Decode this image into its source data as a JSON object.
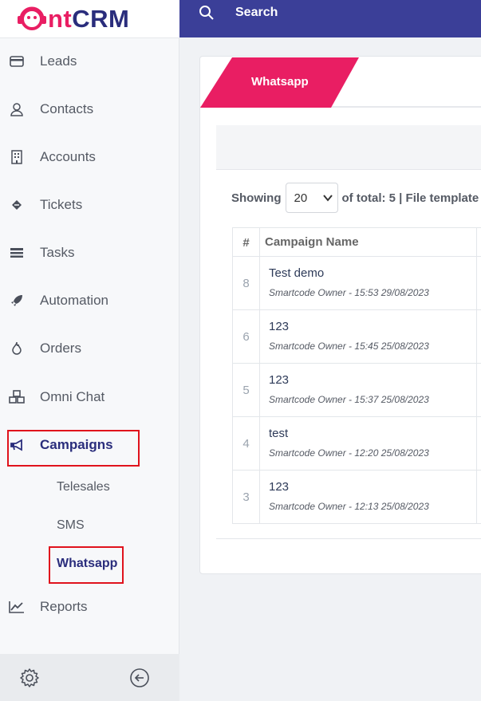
{
  "brand": {
    "logo_prefix": "nt",
    "logo_suffix": "CRM"
  },
  "topbar": {
    "search_label": "Search"
  },
  "sidebar": {
    "items": [
      {
        "label": "Leads",
        "icon": "card-icon"
      },
      {
        "label": "Contacts",
        "icon": "user-icon"
      },
      {
        "label": "Accounts",
        "icon": "building-icon"
      },
      {
        "label": "Tickets",
        "icon": "ticket-icon"
      },
      {
        "label": "Tasks",
        "icon": "tasks-icon"
      },
      {
        "label": "Automation",
        "icon": "rocket-icon"
      },
      {
        "label": "Orders",
        "icon": "fire-icon"
      },
      {
        "label": "Omni Chat",
        "icon": "cubes-icon"
      },
      {
        "label": "Campaigns",
        "icon": "megaphone-icon"
      },
      {
        "label": "Reports",
        "icon": "chart-line-icon"
      }
    ],
    "campaign_subitems": [
      "Telesales",
      "SMS",
      "Whatsapp"
    ]
  },
  "tab": {
    "label": "Whatsapp"
  },
  "list_controls": {
    "showing_label": "Showing",
    "page_size": "20",
    "total_label": "of total: 5 |",
    "file_template_label": "File template"
  },
  "table": {
    "columns": [
      "#",
      "Campaign Name"
    ],
    "rows": [
      {
        "id": "8",
        "name": "Test demo",
        "meta": "Smartcode Owner - 15:53 29/08/2023"
      },
      {
        "id": "6",
        "name": "123",
        "meta": "Smartcode Owner - 15:45 25/08/2023"
      },
      {
        "id": "5",
        "name": "123",
        "meta": "Smartcode Owner - 15:37 25/08/2023"
      },
      {
        "id": "4",
        "name": "test",
        "meta": "Smartcode Owner - 12:20 25/08/2023"
      },
      {
        "id": "3",
        "name": "123",
        "meta": "Smartcode Owner - 12:13 25/08/2023"
      }
    ]
  },
  "colors": {
    "brand_primary": "#3b3f98",
    "brand_accent": "#e91e63",
    "highlight": "#e0121c"
  }
}
